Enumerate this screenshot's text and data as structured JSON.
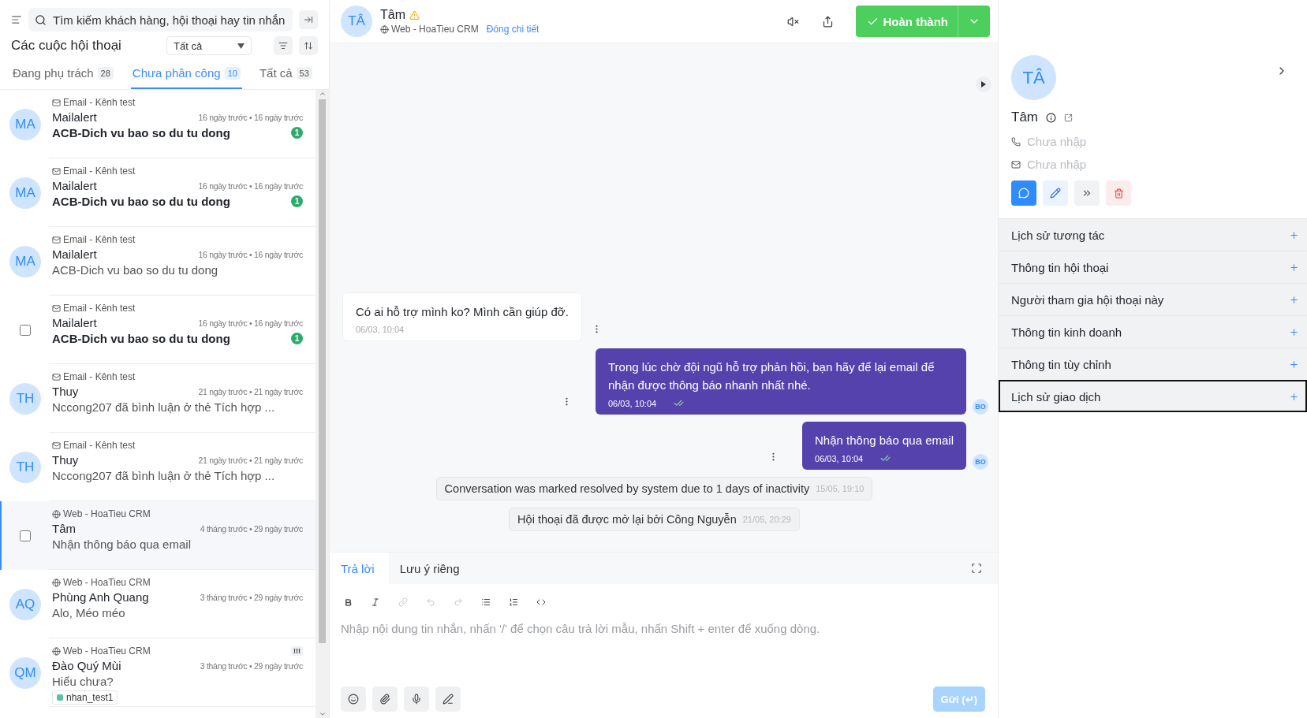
{
  "sidebar": {
    "search": {
      "placeholder": "Tìm kiếm khách hàng, hội thoại hay tin nhắn"
    },
    "title": "Các cuộc hội thoại",
    "filter": {
      "value": "Tất cả"
    },
    "tabs": [
      {
        "label": "Đang phụ trách",
        "count": "28",
        "selected": false
      },
      {
        "label": "Chưa phân công",
        "count": "10",
        "selected": true
      },
      {
        "label": "Tất cả",
        "count": "53",
        "selected": false
      }
    ],
    "conversations": [
      {
        "kind": "avatar",
        "avatar": "MA",
        "channel": {
          "kind": "email",
          "text": "Email - Kênh test"
        },
        "name": "Mailalert",
        "time": "16 ngày trước • 16 ngày trước",
        "preview": "ACB-Dich vu bao so du tu dong",
        "unread_count": "1",
        "selected": false
      },
      {
        "kind": "avatar",
        "avatar": "MA",
        "channel": {
          "kind": "email",
          "text": "Email - Kênh test"
        },
        "name": "Mailalert",
        "time": "16 ngày trước • 16 ngày trước",
        "preview": "ACB-Dich vu bao so du tu dong",
        "unread_count": "1",
        "selected": false
      },
      {
        "kind": "avatar",
        "avatar": "MA",
        "channel": {
          "kind": "email",
          "text": "Email - Kênh test"
        },
        "name": "Mailalert",
        "time": "16 ngày trước • 16 ngày trước",
        "preview": "ACB-Dich vu bao so du tu dong",
        "selected": false
      },
      {
        "kind": "checkbox",
        "checked": false,
        "channel": {
          "kind": "email",
          "text": "Email - Kênh test"
        },
        "name": "Mailalert",
        "time": "16 ngày trước • 16 ngày trước",
        "preview": "ACB-Dich vu bao so du tu dong",
        "unread_count": "1",
        "selected": false
      },
      {
        "kind": "avatar",
        "avatar": "TH",
        "channel": {
          "kind": "email",
          "text": "Email - Kênh test"
        },
        "name": "Thuy",
        "time": "21 ngày trước • 21 ngày trước",
        "preview": "Nccong207 đã bình luận ở thẻ Tích hợp ...",
        "selected": false
      },
      {
        "kind": "avatar",
        "avatar": "TH",
        "channel": {
          "kind": "email",
          "text": "Email - Kênh test"
        },
        "name": "Thuy",
        "time": "21 ngày trước • 21 ngày trước",
        "preview": "Nccong207 đã bình luận ở thẻ Tích hợp ...",
        "selected": false
      },
      {
        "kind": "checkbox",
        "checked": false,
        "channel": {
          "kind": "web",
          "text": "Web - HoaTieu CRM"
        },
        "name": "Tâm",
        "time": "4 tháng trước • 29 ngày trước",
        "preview": "Nhận thông báo qua email",
        "selected": true
      },
      {
        "kind": "avatar",
        "avatar": "AQ",
        "channel": {
          "kind": "web",
          "text": "Web - HoaTieu CRM"
        },
        "name": "Phùng Anh Quang",
        "time": "3 tháng trước • 29 ngày trước",
        "preview": "Alo, Méo méo",
        "selected": false
      },
      {
        "kind": "avatar",
        "avatar": "QM",
        "channel": {
          "kind": "web",
          "text": "Web - HoaTieu CRM"
        },
        "name": "Đào Quý Mùi",
        "time": "3 tháng trước • 29 ngày trước",
        "preview": "Hiểu chưa?",
        "priority": "!!!",
        "labels": [
          {
            "text": "nhan_test1",
            "color": "#5cc0a8"
          }
        ],
        "selected": false
      }
    ]
  },
  "conversation": {
    "header": {
      "avatar": "TÂ",
      "name": "Tâm",
      "channel": "Web - HoaTieu CRM",
      "link": "Đóng chi tiết",
      "resolve_button": "Hoàn thành"
    },
    "messages": [
      {
        "kind": "incoming",
        "text": "Có ai hỗ trợ mình ko? Mình cần giúp đỡ.",
        "time": "06/03, 10:04"
      },
      {
        "kind": "outgoing",
        "text": "Trong lúc chờ đội ngũ hỗ trợ phản hồi, bạn hãy để lại email để nhận được thông báo nhanh nhất nhé.",
        "time": "06/03, 10:04",
        "avatar": "BO",
        "read": true
      },
      {
        "kind": "outgoing",
        "text": "Nhận thông báo qua email",
        "time": "06/03, 10:04",
        "avatar": "BO",
        "read": true
      },
      {
        "kind": "activity",
        "text": "Conversation was marked resolved by system due to 1 days of inactivity",
        "time": "15/05, 19:10"
      },
      {
        "kind": "activity",
        "text": "Hội thoại đã được mở lại bởi Công Nguyễn",
        "time": "21/05, 20:29"
      }
    ]
  },
  "composer": {
    "tabs": [
      {
        "label": "Trả lời",
        "selected": true
      },
      {
        "label": "Lưu ý riêng",
        "selected": false
      }
    ],
    "toolbar": [
      {
        "kind": "bold",
        "disabled": false
      },
      {
        "kind": "italic",
        "disabled": false
      },
      {
        "kind": "link",
        "disabled": true
      },
      {
        "kind": "undo",
        "disabled": true
      },
      {
        "kind": "redo",
        "disabled": true
      },
      {
        "kind": "bullets",
        "disabled": false
      },
      {
        "kind": "numbers",
        "disabled": false
      },
      {
        "kind": "code",
        "disabled": false
      }
    ],
    "placeholder": "Nhập nội dung tin nhắn, nhấn '/' để chọn câu trả lời mẫu, nhấn Shift + enter để xuống dòng.",
    "send_button": {
      "label": "Gửi (↵)",
      "disabled": true
    }
  },
  "contact": {
    "avatar": "TÂ",
    "name": "Tâm",
    "phone": "Chưa nhập",
    "email": "Chưa nhập",
    "sections": [
      {
        "title": "Lịch sử tương tác",
        "selected": false
      },
      {
        "title": "Thông tin hội thoại",
        "selected": false
      },
      {
        "title": "Người tham gia hội thoại này",
        "selected": false
      },
      {
        "title": "Thông tin kinh doanh",
        "selected": false
      },
      {
        "title": "Thông tin tùy chỉnh",
        "selected": false
      },
      {
        "title": "Lịch sử giao dịch",
        "selected": true
      }
    ]
  }
}
